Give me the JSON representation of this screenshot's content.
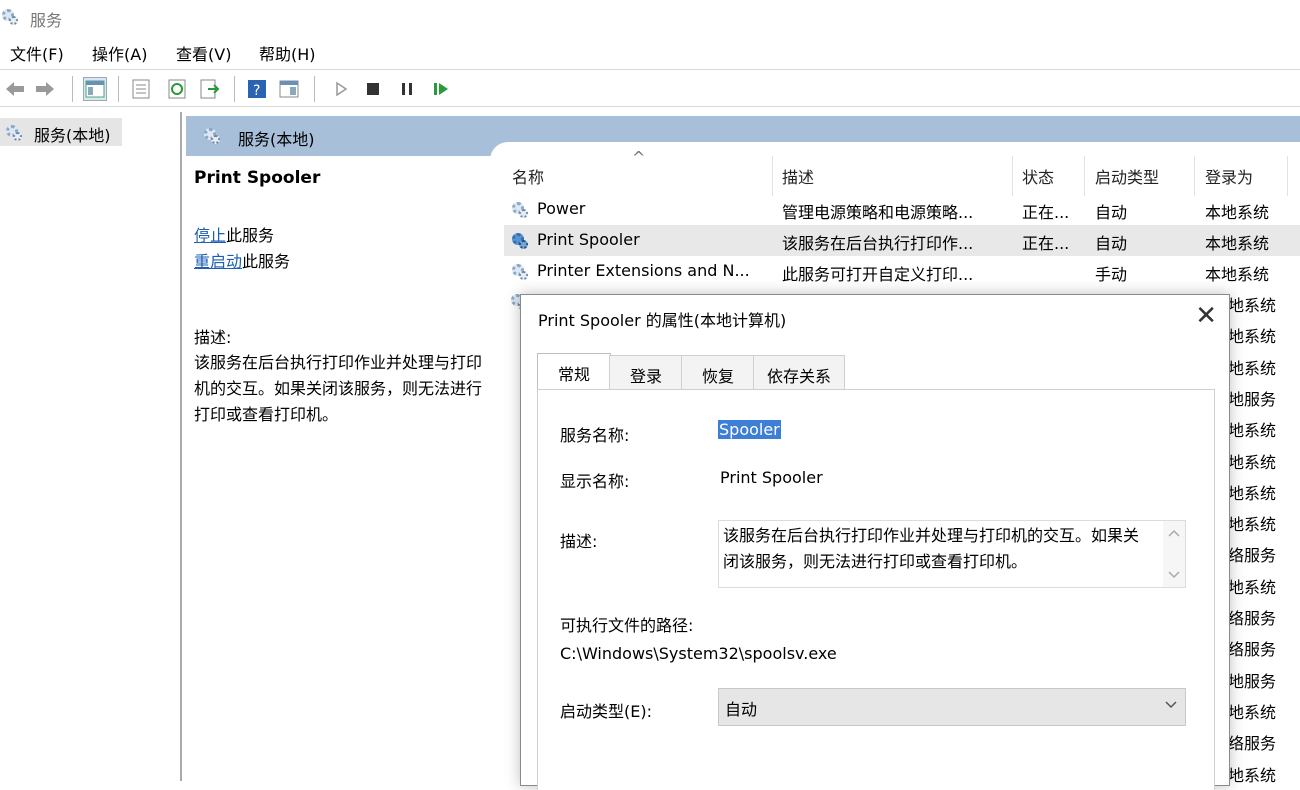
{
  "window": {
    "title": "服务"
  },
  "menu": [
    "文件(F)",
    "操作(A)",
    "查看(V)",
    "帮助(H)"
  ],
  "tree": {
    "root": "服务(本地)"
  },
  "panel_header": "服务(本地)",
  "detail": {
    "service_name": "Print Spooler",
    "stop_link": "停止",
    "stop_suffix": "此服务",
    "restart_link": "重启动",
    "restart_suffix": "此服务",
    "desc_label": "描述:",
    "desc_text": "该服务在后台执行打印作业并处理与打印机的交互。如果关闭该服务，则无法进行打印或查看打印机。"
  },
  "list": {
    "sort_indicator": "^",
    "columns": [
      "名称",
      "描述",
      "状态",
      "启动类型",
      "登录为"
    ],
    "rows": [
      {
        "name": "Power",
        "desc": "管理电源策略和电源策略...",
        "status": "正在...",
        "startup": "自动",
        "logon": "本地系统"
      },
      {
        "name": "Print Spooler",
        "desc": "该服务在后台执行打印作...",
        "status": "正在...",
        "startup": "自动",
        "logon": "本地系统"
      },
      {
        "name": "Printer Extensions and N...",
        "desc": "此服务可打开自定义打印...",
        "status": "",
        "startup": "手动",
        "logon": "本地系统"
      }
    ],
    "hidden_logon": [
      "地系统",
      "地系统",
      "地系统",
      "地服务",
      "地系统",
      "地系统",
      "地系统",
      "地系统",
      "络服务",
      "地系统",
      "络服务",
      "络服务",
      "地服务",
      "地系统",
      "络服务",
      "地系统"
    ]
  },
  "dialog": {
    "title": "Print Spooler 的属性(本地计算机)",
    "close": "✕",
    "tabs": [
      "常规",
      "登录",
      "恢复",
      "依存关系"
    ],
    "service_name_label": "服务名称:",
    "service_name_value": "Spooler",
    "display_name_label": "显示名称:",
    "display_name_value": "Print Spooler",
    "desc_label": "描述:",
    "desc_value": "该服务在后台执行打印作业并处理与打印机的交互。如果关闭该服务，则无法进行打印或查看打印机。",
    "path_label": "可执行文件的路径:",
    "path_value": "C:\\Windows\\System32\\spoolsv.exe",
    "startup_label": "启动类型(E):",
    "startup_value": "自动"
  }
}
